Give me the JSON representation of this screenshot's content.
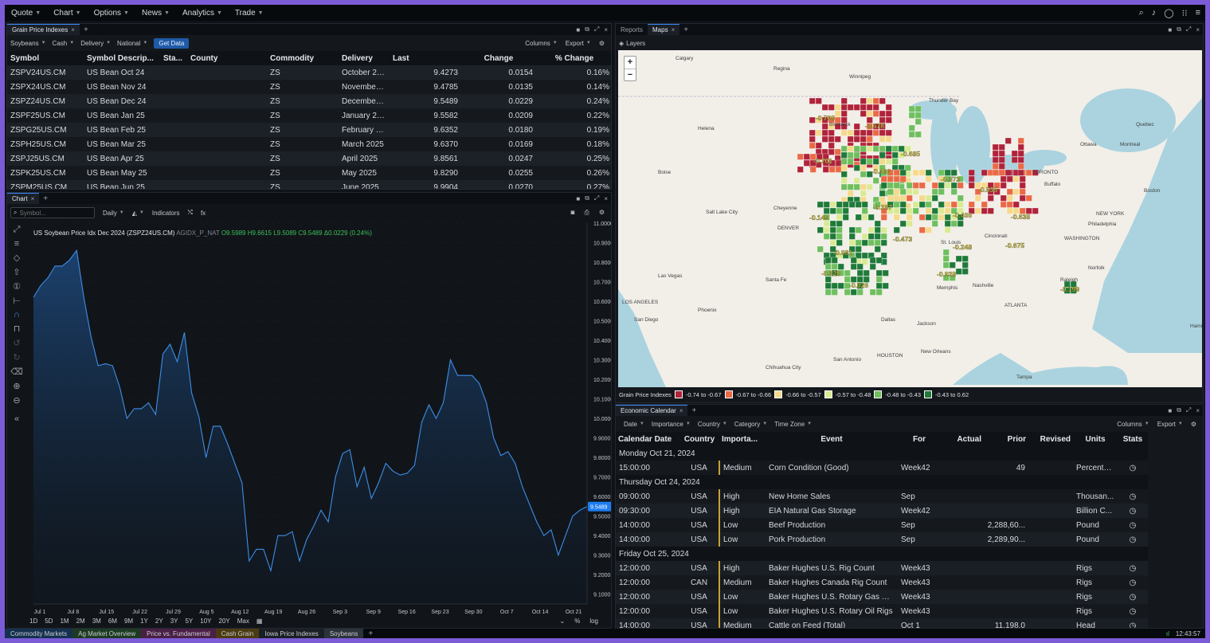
{
  "menu": [
    "Quote",
    "Chart",
    "Options",
    "News",
    "Analytics",
    "Trade"
  ],
  "grain": {
    "tab": "Grain Price Indexes",
    "filters": [
      "Soybeans",
      "Cash",
      "Delivery",
      "National"
    ],
    "get_data": "Get Data",
    "columns_label": "Columns",
    "export_label": "Export",
    "headers": [
      "Symbol",
      "Symbol Descrip...",
      "Sta...",
      "County",
      "Commodity",
      "Delivery",
      "Last",
      "Change",
      "% Change"
    ],
    "rows": [
      [
        "ZSPV24US.CM",
        "US Bean Oct 24",
        "",
        "",
        "ZS",
        "October 20...",
        "9.4273",
        "0.0154",
        "0.16%"
      ],
      [
        "ZSPX24US.CM",
        "US Bean Nov 24",
        "",
        "",
        "ZS",
        "November ...",
        "9.4785",
        "0.0135",
        "0.14%"
      ],
      [
        "ZSPZ24US.CM",
        "US Bean Dec 24",
        "",
        "",
        "ZS",
        "December ...",
        "9.5489",
        "0.0229",
        "0.24%"
      ],
      [
        "ZSPF25US.CM",
        "US Bean Jan 25",
        "",
        "",
        "ZS",
        "January 20...",
        "9.5582",
        "0.0209",
        "0.22%"
      ],
      [
        "ZSPG25US.CM",
        "US Bean Feb 25",
        "",
        "",
        "ZS",
        "February 2...",
        "9.6352",
        "0.0180",
        "0.19%"
      ],
      [
        "ZSPH25US.CM",
        "US Bean Mar 25",
        "",
        "",
        "ZS",
        "March 2025",
        "9.6370",
        "0.0169",
        "0.18%"
      ],
      [
        "ZSPJ25US.CM",
        "US Bean Apr 25",
        "",
        "",
        "ZS",
        "April 2025",
        "9.8561",
        "0.0247",
        "0.25%"
      ],
      [
        "ZSPK25US.CM",
        "US Bean May 25",
        "",
        "",
        "ZS",
        "May 2025",
        "9.8290",
        "0.0255",
        "0.26%"
      ],
      [
        "ZSPM25US.CM",
        "US Bean Jun 25",
        "",
        "",
        "ZS",
        "June 2025",
        "9.9904",
        "0.0270",
        "0.27%"
      ]
    ]
  },
  "chart_panel": {
    "tab": "Chart",
    "symbol_placeholder": "Symbol...",
    "interval": "Daily",
    "indicators": "Indicators",
    "fx": "fx",
    "title": "US Soybean Price Idx Dec 2024 (ZSPZ24US.CM)",
    "source": "AGIDX_P_NAT",
    "ohlc": "O9.5989 H9.6615 L9.5089 C9.5489 Δ0.0229 (0.24%)",
    "last_price": "9.5489",
    "timeframes": [
      "1D",
      "5D",
      "1M",
      "2M",
      "3M",
      "6M",
      "9M",
      "1Y",
      "2Y",
      "3Y",
      "5Y",
      "10Y",
      "20Y",
      "Max"
    ],
    "scale_pct": "%",
    "scale_log": "log"
  },
  "chart_data": {
    "type": "area",
    "title": "US Soybean Price Idx Dec 2024 (ZSPZ24US.CM)",
    "x_ticks": [
      "Jul 1",
      "Jul 8",
      "Jul 15",
      "Jul 22",
      "Jul 29",
      "Aug 5",
      "Aug 12",
      "Aug 19",
      "Aug 26",
      "Sep 3",
      "Sep 9",
      "Sep 16",
      "Sep 23",
      "Sep 30",
      "Oct 7",
      "Oct 14",
      "Oct 21"
    ],
    "y_ticks": [
      "11.0000",
      "10.9000",
      "10.8000",
      "10.7000",
      "10.6000",
      "10.5000",
      "10.4000",
      "10.3000",
      "10.2000",
      "10.1000",
      "10.0000",
      "9.9000",
      "9.8000",
      "9.7000",
      "9.6000",
      "9.5000",
      "9.4000",
      "9.3000",
      "9.2000",
      "9.1000"
    ],
    "ylim": [
      9.05,
      11.0
    ],
    "values": [
      10.62,
      10.68,
      10.72,
      10.78,
      10.78,
      10.81,
      10.86,
      10.62,
      10.42,
      10.27,
      10.28,
      10.27,
      10.16,
      10.0,
      10.05,
      10.05,
      10.08,
      10.02,
      10.33,
      10.38,
      10.29,
      10.44,
      10.13,
      10.01,
      9.8,
      9.96,
      9.96,
      9.87,
      9.77,
      9.67,
      9.27,
      9.33,
      9.33,
      9.22,
      9.4,
      9.4,
      9.42,
      9.27,
      9.38,
      9.45,
      9.53,
      9.47,
      9.7,
      9.82,
      9.84,
      9.65,
      9.75,
      9.59,
      9.67,
      9.77,
      9.73,
      9.71,
      9.72,
      9.76,
      9.98,
      10.07,
      10.0,
      10.08,
      10.3,
      10.22,
      10.22,
      10.22,
      10.18,
      10.08,
      9.9,
      9.81,
      9.83,
      9.77,
      9.65,
      9.56,
      9.47,
      9.4,
      9.43,
      9.3,
      9.4,
      9.5,
      9.53,
      9.5489
    ]
  },
  "maps": {
    "tabs": [
      "Reports",
      "Maps"
    ],
    "layers": "Layers",
    "legend_title": "Grain Price Indexes",
    "legend": [
      {
        "label": "-0.74 to -0.67",
        "color": "#b0233a"
      },
      {
        "label": "-0.67 to -0.66",
        "color": "#ea6a46"
      },
      {
        "label": "-0.66 to -0.57",
        "color": "#f5d98c"
      },
      {
        "label": "-0.57 to -0.48",
        "color": "#d9ea93"
      },
      {
        "label": "-0.48 to -0.43",
        "color": "#6fbf5e"
      },
      {
        "label": "-0.43 to 0.62",
        "color": "#1f7a3a"
      }
    ],
    "cities": [
      "Calgary",
      "Regina",
      "Winnipeg",
      "Thunder Bay",
      "Helena",
      "Bismarck",
      "Quebec",
      "Ottawa",
      "Montreal",
      "Boise",
      "TORONTO",
      "Buffalo",
      "Boston",
      "Salt Lake City",
      "Cheyenne",
      "DENVER",
      "NEW YORK",
      "Philadelphia",
      "WASHINGTON",
      "Las Vegas",
      "Santa Fe",
      "Norfolk",
      "Raleigh",
      "LOS ANGELES",
      "Phoenix",
      "ATLANTA",
      "Memphis",
      "Nashville",
      "St. Louis",
      "Dallas",
      "Jackson",
      "San Diego",
      "HOUSTON",
      "New Orleans",
      "San Antonio",
      "Chihuahua City",
      "Tampa",
      "Hamil",
      "Cincinnati"
    ],
    "values": [
      "-0.708",
      "-0.678",
      "-0.701",
      "-0.685",
      "-0.406",
      "-0.373",
      "-0.149",
      "-0.287",
      "-0.405",
      "-0.535",
      "-0.638",
      "-0.473",
      "-0.248",
      "-0.675",
      "-0.031",
      "-0.328",
      "-0.026",
      "-0.928",
      "-0.199"
    ],
    "zoom_in": "+",
    "zoom_out": "−"
  },
  "econ": {
    "tab": "Economic Calendar",
    "filters": [
      "Date",
      "Importance",
      "Country",
      "Category",
      "Time Zone"
    ],
    "columns_label": "Columns",
    "export_label": "Export",
    "headers": [
      "Calendar Date",
      "Country",
      "Importa...",
      "Event",
      "For",
      "Actual",
      "Prior",
      "Revised",
      "Units",
      "Stats"
    ],
    "groups": [
      {
        "date": "Monday Oct 21, 2024",
        "rows": [
          [
            "15:00:00",
            "USA",
            "Medium",
            "Corn Condition (Good)",
            "Week42",
            "",
            "49",
            "",
            "Percenta..."
          ]
        ]
      },
      {
        "date": "Thursday Oct 24, 2024",
        "rows": [
          [
            "09:00:00",
            "USA",
            "High",
            "New Home Sales",
            "Sep",
            "",
            "",
            "",
            "Thousan..."
          ],
          [
            "09:30:00",
            "USA",
            "High",
            "EIA Natural Gas Storage",
            "Week42",
            "",
            "",
            "",
            "Billion C..."
          ],
          [
            "14:00:00",
            "USA",
            "Low",
            "Beef Production",
            "Sep",
            "",
            "2,288,60...",
            "",
            "Pound"
          ],
          [
            "14:00:00",
            "USA",
            "Low",
            "Pork Production",
            "Sep",
            "",
            "2,289,90...",
            "",
            "Pound"
          ]
        ]
      },
      {
        "date": "Friday Oct 25, 2024",
        "rows": [
          [
            "12:00:00",
            "USA",
            "High",
            "Baker Hughes U.S. Rig Count",
            "Week43",
            "",
            "",
            "",
            "Rigs"
          ],
          [
            "12:00:00",
            "CAN",
            "Medium",
            "Baker Hughes Canada Rig Count",
            "Week43",
            "",
            "",
            "",
            "Rigs"
          ],
          [
            "12:00:00",
            "USA",
            "Low",
            "Baker Hughes U.S. Rotary Gas Rigs",
            "Week43",
            "",
            "",
            "",
            "Rigs"
          ],
          [
            "12:00:00",
            "USA",
            "Low",
            "Baker Hughes U.S. Rotary Oil Rigs",
            "Week43",
            "",
            "",
            "",
            "Rigs"
          ],
          [
            "14:00:00",
            "USA",
            "Medium",
            "Cattle on Feed (Total)",
            "Oct 1",
            "",
            "11,198.0",
            "",
            "Head"
          ]
        ]
      }
    ]
  },
  "bottom_tabs": [
    {
      "label": "Commodity Markets",
      "color": "#15314f"
    },
    {
      "label": "Ag Market Overview",
      "color": "#1d3b22"
    },
    {
      "label": "Price vs. Fundamental",
      "color": "#4a1f45"
    },
    {
      "label": "Cash Grain",
      "color": "#4a3b12"
    },
    {
      "label": "Iowa Price Indexes",
      "color": "#1a1f25"
    },
    {
      "label": "Soybeans",
      "color": "#2c323a"
    }
  ],
  "clock": "12:43:57"
}
